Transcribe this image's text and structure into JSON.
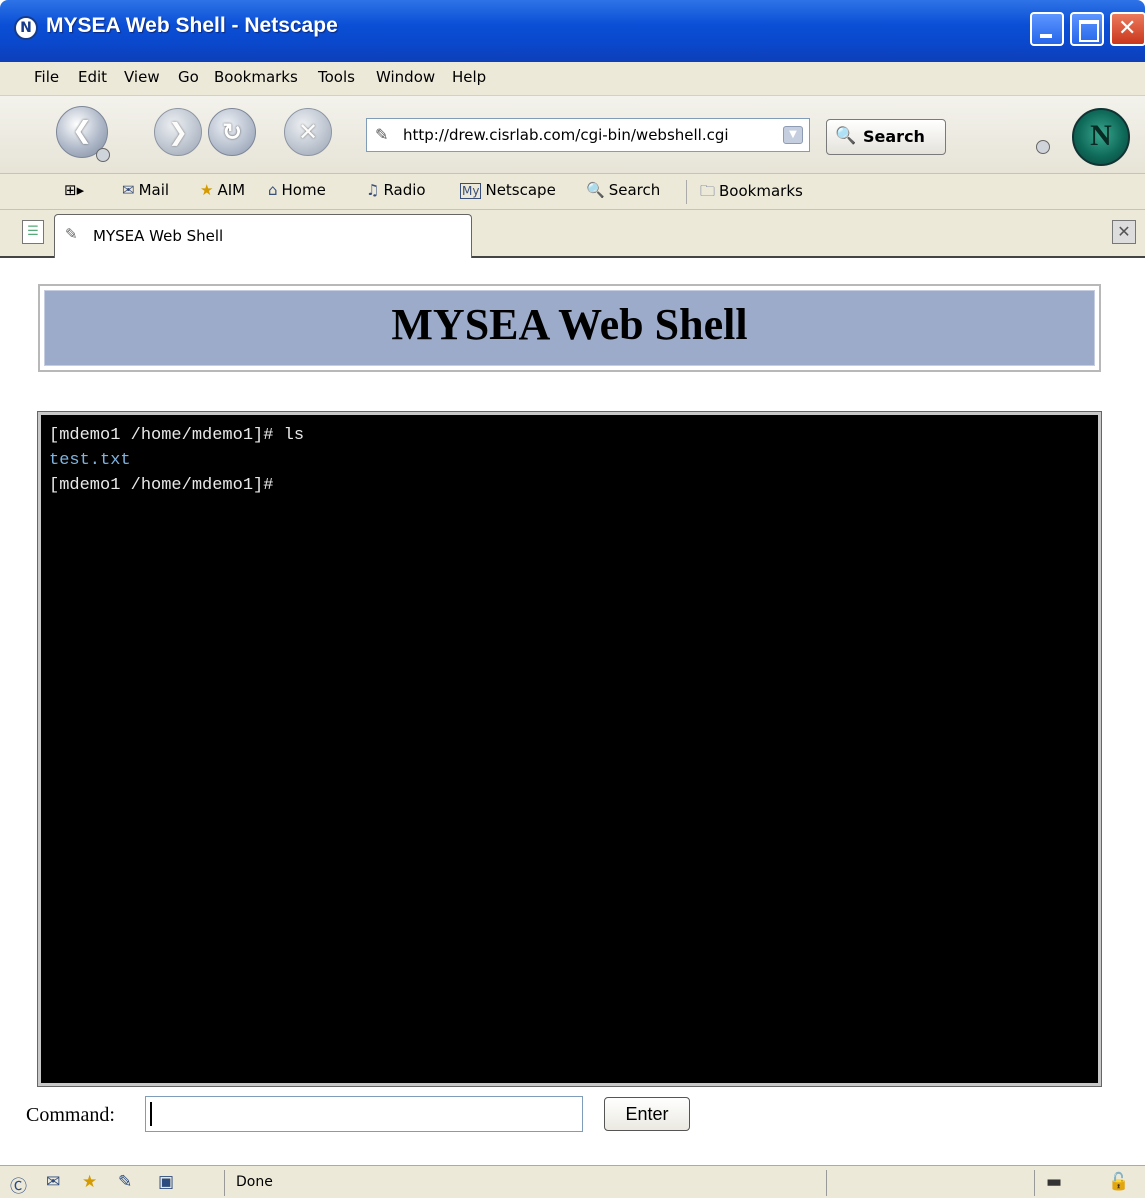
{
  "window": {
    "title": "MYSEA Web Shell - Netscape",
    "logo_letter": "N"
  },
  "menu": [
    "File",
    "Edit",
    "View",
    "Go",
    "Bookmarks",
    "Tools",
    "Window",
    "Help"
  ],
  "navigation": {
    "url": "http://drew.cisrlab.com/cgi-bin/webshell.cgi",
    "search_label": "Search"
  },
  "personal_toolbar": {
    "items": [
      "Mail",
      "AIM",
      "Home",
      "Radio",
      "Netscape",
      "Search",
      "Bookmarks"
    ]
  },
  "tabs": [
    {
      "label": "MYSEA Web Shell"
    }
  ],
  "page": {
    "banner_title": "MYSEA Web Shell",
    "terminal_lines": [
      {
        "text": "[mdemo1 /home/mdemo1]# ls",
        "type": "prompt"
      },
      {
        "text": "test.txt",
        "type": "output"
      },
      {
        "text": "[mdemo1 /home/mdemo1]#",
        "type": "prompt"
      }
    ],
    "command_label": "Command:",
    "command_value": "",
    "enter_label": "Enter"
  },
  "status": {
    "text": "Done"
  },
  "icons": {
    "back": "back-arrow-icon",
    "forward": "forward-arrow-icon",
    "reload": "reload-icon",
    "stop": "stop-icon",
    "print": "print-icon",
    "netscape": "netscape-logo-icon"
  },
  "colors": {
    "titlebar": "#0a4fd6",
    "banner": "#9dabca",
    "terminal_bg": "#000000",
    "terminal_output": "#7fb3e0"
  }
}
